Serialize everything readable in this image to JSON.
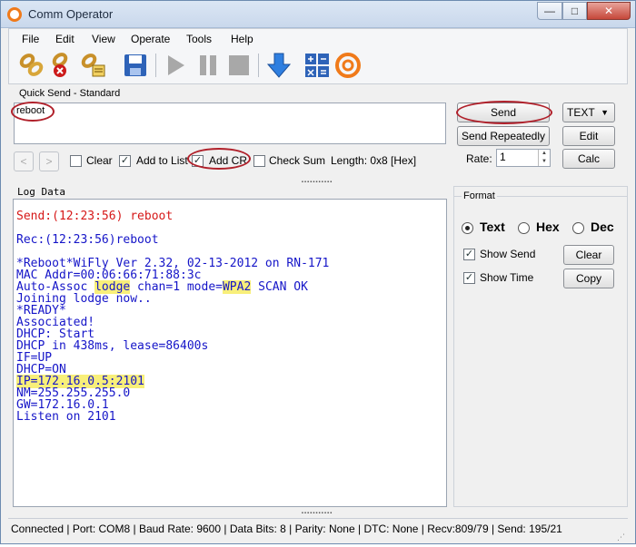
{
  "window": {
    "title": "Comm Operator",
    "controls": {
      "minimize": "—",
      "maximize": "□",
      "close": "✕"
    }
  },
  "menu": [
    "File",
    "Edit",
    "View",
    "Operate",
    "Tools",
    "Help"
  ],
  "toolbar": {
    "icons": [
      "connect-icon",
      "disconnect-icon",
      "properties-icon",
      "save-icon",
      "play-icon",
      "pause-icon",
      "stop-icon",
      "download-icon",
      "calculator-icon",
      "app-logo-icon"
    ]
  },
  "quick_send": {
    "label": "Quick Send - Standard",
    "text": "reboot",
    "send": "Send",
    "send_repeatedly": "Send Repeatedly",
    "mode": "TEXT",
    "edit": "Edit",
    "calc": "Calc",
    "rate_label": "Rate:",
    "rate_value": "1",
    "clear_label": "Clear",
    "add_to_list_label": "Add to List",
    "add_cr_label": "Add CR",
    "check_sum_label": "Check Sum",
    "length": "Length: 0x8 [Hex]",
    "clear_checked": false,
    "add_to_list_checked": true,
    "add_cr_checked": true,
    "check_sum_checked": false
  },
  "log": {
    "label": "Log Data",
    "send_line": "Send:(12:23:56) reboot",
    "rec_line": "Rec:(12:23:56)reboot",
    "l1": "*Reboot*WiFly Ver 2.32, 02-13-2012 on RN-171",
    "l2": "MAC Addr=00:06:66:71:88:3c",
    "l3a": "Auto-Assoc ",
    "l3b": "lodge",
    "l3c": " chan=1 mode=",
    "l3d": "WPA2",
    "l3e": " SCAN OK",
    "l4": "Joining lodge now..",
    "l5": "*READY*",
    "l6": "Associated!",
    "l7": "DHCP: Start",
    "l8": "DHCP in 438ms, lease=86400s",
    "l9": "IF=UP",
    "l10": "DHCP=ON",
    "l11": "IP=172.16.0.5:2101",
    "l12": "NM=255.255.255.0",
    "l13": "GW=172.16.0.1",
    "l14": "Listen on 2101"
  },
  "format": {
    "label": "Format",
    "text": "Text",
    "hex": "Hex",
    "dec": "Dec",
    "selected": "Text"
  },
  "options": {
    "show_send": "Show Send",
    "show_time": "Show Time",
    "clear": "Clear",
    "copy": "Copy",
    "show_send_checked": true,
    "show_time_checked": true
  },
  "status": "Connected | Port: COM8 | Baud Rate: 9600 | Data Bits: 8 | Parity: None | DTC: None | Recv:809/79 | Send: 195/21",
  "colors": {
    "send_text": "#d61818",
    "log_text": "#1515c8",
    "highlight": "#f8ef7a",
    "annotation": "#b0202a"
  }
}
